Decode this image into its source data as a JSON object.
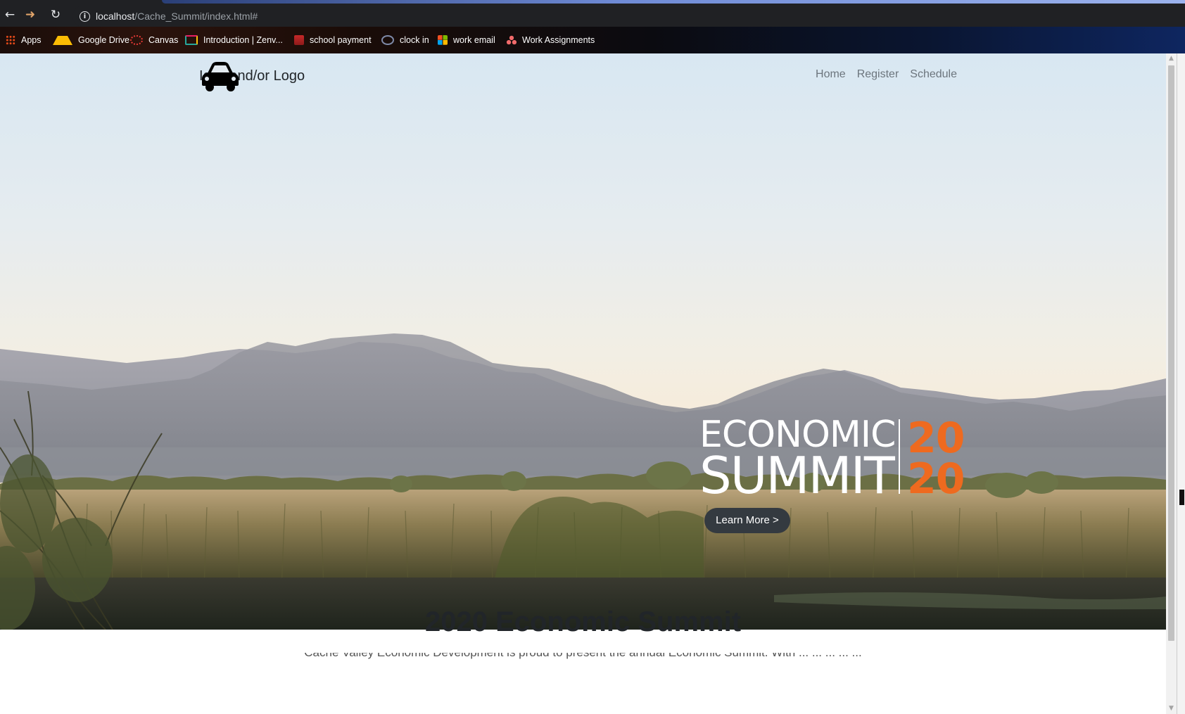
{
  "browser": {
    "url_host": "localhost",
    "url_path": "/Cache_Summit/index.html#",
    "back_icon": "arrow-left-icon",
    "forward_icon": "arrow-right-icon",
    "reload_icon": "reload-icon",
    "info_icon": "info-icon"
  },
  "bookmarks": [
    {
      "label": "Apps",
      "icon": "apps-grid-icon"
    },
    {
      "label": "Google Drive",
      "icon": "google-drive-icon"
    },
    {
      "label": "Canvas",
      "icon": "canvas-icon"
    },
    {
      "label": "Introduction | Zenv...",
      "icon": "zenva-icon"
    },
    {
      "label": "school payment",
      "icon": "school-payment-icon"
    },
    {
      "label": "clock in",
      "icon": "clock-in-icon"
    },
    {
      "label": "work email",
      "icon": "microsoft-icon"
    },
    {
      "label": "Work Assignments",
      "icon": "asana-icon"
    }
  ],
  "site": {
    "brand_icon": "car-icon",
    "brand_text": "Icon and/or Logo",
    "nav": [
      "Home",
      "Register",
      "Schedule"
    ]
  },
  "hero": {
    "logo_line1": "ECONOMIC",
    "logo_line2": "SUMMIT",
    "logo_year1": "20",
    "logo_year2": "20",
    "year_color": "#ee6a1f",
    "button_label": "Learn More >",
    "button_color": "#343a40"
  },
  "content": {
    "title": "2020 Economic Summit",
    "paragraph": "Cache Valley Economic Development is proud to present the annual Economic Summit. With ... ... ... ... ..."
  }
}
